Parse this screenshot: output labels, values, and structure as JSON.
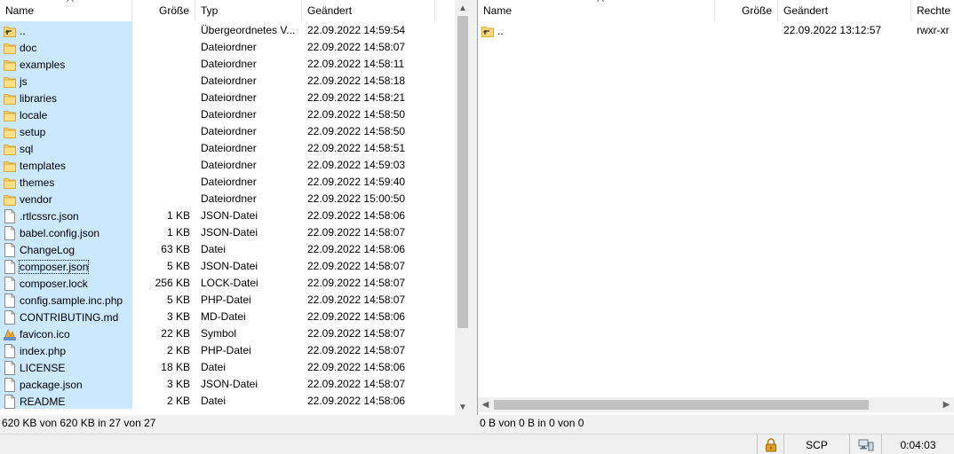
{
  "left": {
    "columns": {
      "name": "Name",
      "size": "Größe",
      "type": "Typ",
      "changed": "Geändert"
    },
    "rows": [
      {
        "icon": "parent-folder-icon",
        "name": "..",
        "size": "",
        "type": "Übergeordnetes V...",
        "changed": "22.09.2022  14:59:54"
      },
      {
        "icon": "folder-icon",
        "name": "doc",
        "size": "",
        "type": "Dateiordner",
        "changed": "22.09.2022  14:58:07"
      },
      {
        "icon": "folder-icon",
        "name": "examples",
        "size": "",
        "type": "Dateiordner",
        "changed": "22.09.2022  14:58:11"
      },
      {
        "icon": "folder-icon",
        "name": "js",
        "size": "",
        "type": "Dateiordner",
        "changed": "22.09.2022  14:58:18"
      },
      {
        "icon": "folder-icon",
        "name": "libraries",
        "size": "",
        "type": "Dateiordner",
        "changed": "22.09.2022  14:58:21"
      },
      {
        "icon": "folder-icon",
        "name": "locale",
        "size": "",
        "type": "Dateiordner",
        "changed": "22.09.2022  14:58:50"
      },
      {
        "icon": "folder-icon",
        "name": "setup",
        "size": "",
        "type": "Dateiordner",
        "changed": "22.09.2022  14:58:50"
      },
      {
        "icon": "folder-icon",
        "name": "sql",
        "size": "",
        "type": "Dateiordner",
        "changed": "22.09.2022  14:58:51"
      },
      {
        "icon": "folder-icon",
        "name": "templates",
        "size": "",
        "type": "Dateiordner",
        "changed": "22.09.2022  14:59:03"
      },
      {
        "icon": "folder-icon",
        "name": "themes",
        "size": "",
        "type": "Dateiordner",
        "changed": "22.09.2022  14:59:40"
      },
      {
        "icon": "folder-icon",
        "name": "vendor",
        "size": "",
        "type": "Dateiordner",
        "changed": "22.09.2022  15:00:50"
      },
      {
        "icon": "file-icon",
        "name": ".rtlcssrc.json",
        "size": "1 KB",
        "type": "JSON-Datei",
        "changed": "22.09.2022  14:58:06"
      },
      {
        "icon": "file-icon",
        "name": "babel.config.json",
        "size": "1 KB",
        "type": "JSON-Datei",
        "changed": "22.09.2022  14:58:07"
      },
      {
        "icon": "file-icon",
        "name": "ChangeLog",
        "size": "63 KB",
        "type": "Datei",
        "changed": "22.09.2022  14:58:06"
      },
      {
        "icon": "file-icon",
        "name": "composer.json",
        "size": "5 KB",
        "type": "JSON-Datei",
        "changed": "22.09.2022  14:58:07"
      },
      {
        "icon": "file-icon",
        "name": "composer.lock",
        "size": "256 KB",
        "type": "LOCK-Datei",
        "changed": "22.09.2022  14:58:07"
      },
      {
        "icon": "file-icon",
        "name": "config.sample.inc.php",
        "size": "5 KB",
        "type": "PHP-Datei",
        "changed": "22.09.2022  14:58:07"
      },
      {
        "icon": "file-icon",
        "name": "CONTRIBUTING.md",
        "size": "3 KB",
        "type": "MD-Datei",
        "changed": "22.09.2022  14:58:06"
      },
      {
        "icon": "favicon-icon",
        "name": "favicon.ico",
        "size": "22 KB",
        "type": "Symbol",
        "changed": "22.09.2022  14:58:07"
      },
      {
        "icon": "file-icon",
        "name": "index.php",
        "size": "2 KB",
        "type": "PHP-Datei",
        "changed": "22.09.2022  14:58:07"
      },
      {
        "icon": "file-icon",
        "name": "LICENSE",
        "size": "18 KB",
        "type": "Datei",
        "changed": "22.09.2022  14:58:06"
      },
      {
        "icon": "file-icon",
        "name": "package.json",
        "size": "3 KB",
        "type": "JSON-Datei",
        "changed": "22.09.2022  14:58:07"
      },
      {
        "icon": "file-icon",
        "name": "README",
        "size": "2 KB",
        "type": "Datei",
        "changed": "22.09.2022  14:58:06"
      }
    ],
    "status": "620 KB von 620 KB in 27 von 27"
  },
  "right": {
    "columns": {
      "name": "Name",
      "size": "Größe",
      "changed": "Geändert",
      "rights": "Rechte"
    },
    "rows": [
      {
        "icon": "parent-folder-icon",
        "name": "..",
        "size": "",
        "changed": "22.09.2022 13:12:57",
        "rights": "rwxr-xr"
      }
    ],
    "status": "0 B von 0 B in 0 von 0"
  },
  "bottombar": {
    "protocol": "SCP",
    "elapsed": "0:04:03",
    "lock_icon": "lock-icon",
    "queue_icon": "computer-network-icon"
  },
  "colors": {
    "selection": "#cce8ff",
    "folder": "#f8d775",
    "lock": "#e0a020"
  }
}
